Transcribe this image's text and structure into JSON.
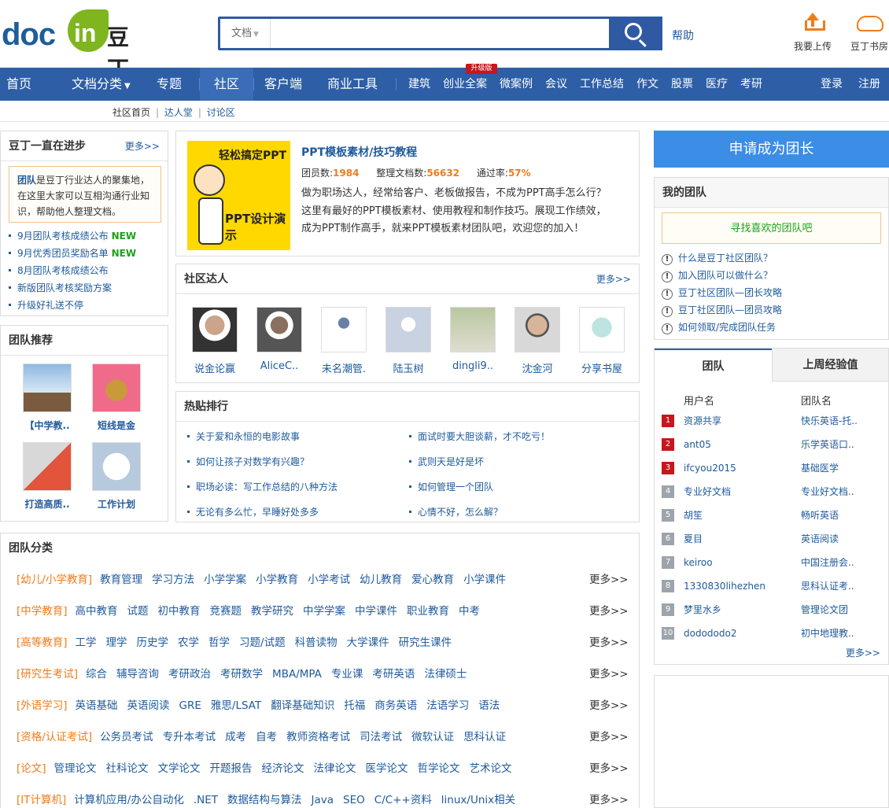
{
  "header": {
    "logo_doc": "doc",
    "logo_in": "in",
    "logo_cn": "豆丁",
    "search_type": "文档",
    "search_value": "",
    "help": "帮助",
    "upload": "我要上传",
    "study": "豆丁书房"
  },
  "nav": {
    "items": [
      "首页",
      "文档分类",
      "专题",
      "社区",
      "客户端",
      "商业工具"
    ],
    "links": [
      "建筑",
      "创业全案",
      "微案例",
      "会议",
      "工作总结",
      "作文",
      "股票",
      "医疗",
      "考研"
    ],
    "badge": "升级版",
    "login": "登录",
    "register": "注册"
  },
  "subnav": {
    "items": [
      "社区首页",
      "达人堂",
      "讨论区"
    ]
  },
  "progress": {
    "title": "豆丁一直在进步",
    "more": "更多>>",
    "intro_bold": "团队",
    "intro_text": "是豆丁行业达人的聚集地，在这里大家可以互相沟通行业知识，帮助他人整理文档。",
    "items": [
      {
        "text": "9月团队考核成绩公布",
        "new": "NEW"
      },
      {
        "text": "9月优秀团员奖励名单",
        "new": "NEW"
      },
      {
        "text": "8月团队考核成绩公布",
        "new": ""
      },
      {
        "text": "新版团队考核奖励方案",
        "new": ""
      },
      {
        "text": "升级好礼送不停",
        "new": ""
      }
    ]
  },
  "recommend": {
    "title": "团队推荐",
    "teams": [
      "【中学教..",
      "短线是金",
      "打造高质..",
      "工作计划"
    ]
  },
  "feature": {
    "img_text1": "轻松搞定PPT",
    "img_text2": "PPT设计演示",
    "title": "PPT模板素材/技巧教程",
    "members_label": "团员数:",
    "members": "1984",
    "docs_label": "整理文档数:",
    "docs": "56632",
    "pass_label": "通过率:",
    "pass": "57%",
    "desc": "做为职场达人，经常给客户、老板做报告，不成为PPT高手怎么行？这里有最好的PPT模板素材、使用教程和制作技巧。展现工作绩效，成为PPT制作高手，就来PPT模板素材团队吧，欢迎您的加入！"
  },
  "experts": {
    "title": "社区达人",
    "more": "更多>>",
    "people": [
      "说金论赢",
      "AliceC..",
      "未名潮管.",
      "陆玉树",
      "dingli9..",
      "沈金河",
      "分享书屋"
    ]
  },
  "hot": {
    "title": "热贴排行",
    "posts": [
      "关于爱和永恒的电影故事",
      "面试时要大胆谈薪，才不吃亏！",
      "如何让孩子对数学有兴趣？",
      "武则天是好是坏",
      "职场必读：写工作总结的八种方法",
      "如何管理一个团队",
      "无论有多么忙，早睡好处多多",
      "心情不好，怎么解？"
    ]
  },
  "categories": {
    "title": "团队分类",
    "more": "更多>>",
    "rows": [
      {
        "name": "[幼儿/小学教育]",
        "items": [
          "教育管理",
          "学习方法",
          "小学学案",
          "小学教育",
          "小学考试",
          "幼儿教育",
          "爱心教育",
          "小学课件"
        ]
      },
      {
        "name": "[中学教育]",
        "items": [
          "高中教育",
          "试题",
          "初中教育",
          "竞赛题",
          "教学研究",
          "中学学案",
          "中学课件",
          "职业教育",
          "中考"
        ]
      },
      {
        "name": "[高等教育]",
        "items": [
          "工学",
          "理学",
          "历史学",
          "农学",
          "哲学",
          "习题/试题",
          "科普读物",
          "大学课件",
          "研究生课件"
        ]
      },
      {
        "name": "[研究生考试]",
        "items": [
          "综合",
          "辅导咨询",
          "考研政治",
          "考研数学",
          "MBA/MPA",
          "专业课",
          "考研英语",
          "法律硕士"
        ]
      },
      {
        "name": "[外语学习]",
        "items": [
          "英语基础",
          "英语阅读",
          "GRE",
          "雅思/LSAT",
          "翻译基础知识",
          "托福",
          "商务英语",
          "法语学习",
          "语法"
        ]
      },
      {
        "name": "[资格/认证考试]",
        "items": [
          "公务员考试",
          "专升本考试",
          "成考",
          "自考",
          "教师资格考试",
          "司法考试",
          "微软认证",
          "思科认证"
        ]
      },
      {
        "name": "[论文]",
        "items": [
          "管理论文",
          "社科论文",
          "文学论文",
          "开题报告",
          "经济论文",
          "法律论文",
          "医学论文",
          "哲学论文",
          "艺术论文"
        ]
      },
      {
        "name": "[IT计算机]",
        "items": [
          "计算机应用/办公自动化",
          ".NET",
          "数据结构与算法",
          "Java",
          "SEO",
          "C/C++资料",
          "linux/Unix相关"
        ]
      }
    ]
  },
  "apply": {
    "label": "申请成为团长"
  },
  "myteam": {
    "title": "我的团队",
    "find": "寻找喜欢的团队吧",
    "faqs": [
      "什么是豆丁社区团队？",
      "加入团队可以做什么？",
      "豆丁社区团队—团长攻略",
      "豆丁社区团队—团员攻略",
      "如何领取/完成团队任务"
    ]
  },
  "rank": {
    "tab1": "团队",
    "tab2": "上周经验值",
    "col_user": "用户名",
    "col_team": "团队名",
    "rows": [
      {
        "no": "1",
        "user": "资源共享",
        "team": "快乐英语-托.."
      },
      {
        "no": "2",
        "user": "ant05",
        "team": "乐学英语口.."
      },
      {
        "no": "3",
        "user": "ifcyou2015",
        "team": "基础医学"
      },
      {
        "no": "4",
        "user": "专业好文档",
        "team": "专业好文档.."
      },
      {
        "no": "5",
        "user": "胡笙",
        "team": "畅听英语"
      },
      {
        "no": "6",
        "user": "夏目",
        "team": "英语阅读"
      },
      {
        "no": "7",
        "user": "keiroo",
        "team": "中国注册会.."
      },
      {
        "no": "8",
        "user": "1330830lihezhen",
        "team": "思科认证考.."
      },
      {
        "no": "9",
        "user": "梦里水乡",
        "team": "管理论文团"
      },
      {
        "no": "10",
        "user": "dodododo2",
        "team": "初中地理教.."
      }
    ],
    "more": "更多>>"
  },
  "colors": {
    "brand_blue": "#2e5ea6",
    "accent_orange": "#f07c1a",
    "green": "#19a319",
    "rank_red": "#c8161d"
  }
}
